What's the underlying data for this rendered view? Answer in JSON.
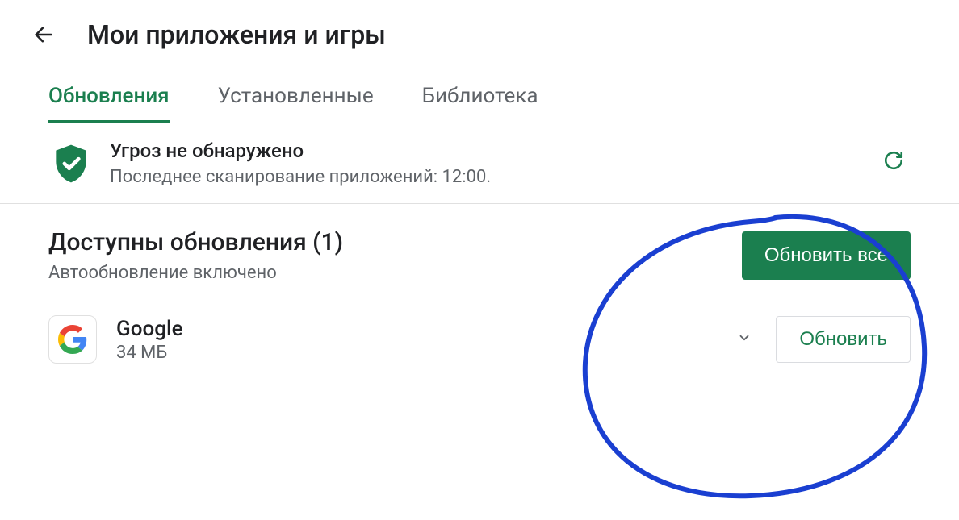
{
  "header": {
    "title": "Мои приложения и игры"
  },
  "tabs": [
    {
      "label": "Обновления",
      "active": true
    },
    {
      "label": "Установленные",
      "active": false
    },
    {
      "label": "Библиотека",
      "active": false
    }
  ],
  "security": {
    "title": "Угроз не обнаружено",
    "subtitle": "Последнее сканирование приложений: 12:00."
  },
  "updates": {
    "title": "Доступны обновления (1)",
    "subtitle": "Автообновление включено",
    "update_all_label": "Обновить все"
  },
  "apps": [
    {
      "name": "Google",
      "size": "34 МБ",
      "update_label": "Обновить"
    }
  ],
  "colors": {
    "accent": "#1b7f4f",
    "annotation": "#1a3fd1"
  }
}
